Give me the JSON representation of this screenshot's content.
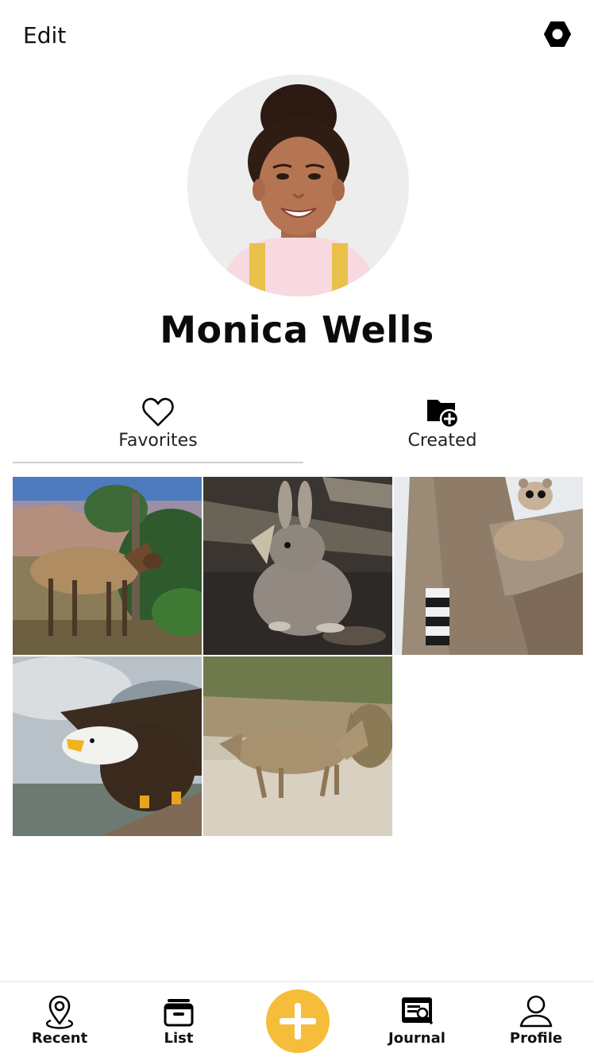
{
  "header": {
    "edit_label": "Edit",
    "settings_icon": "gear-hexagon-icon"
  },
  "profile": {
    "name": "Monica Wells",
    "avatar_icon": "avatar-photo"
  },
  "tabs": [
    {
      "label": "Favorites",
      "icon": "heart-icon",
      "active": true
    },
    {
      "label": "Created",
      "icon": "folder-add-icon",
      "active": false
    }
  ],
  "photos": [
    {
      "subject": "elk"
    },
    {
      "subject": "rabbit"
    },
    {
      "subject": "ringtail"
    },
    {
      "subject": "bald eagle"
    },
    {
      "subject": "coyote"
    }
  ],
  "bottom_nav": {
    "items": [
      {
        "label": "Recent",
        "icon": "map-pin-icon"
      },
      {
        "label": "List",
        "icon": "list-box-icon"
      },
      {
        "label": "",
        "icon": "plus-icon"
      },
      {
        "label": "Journal",
        "icon": "journal-icon"
      },
      {
        "label": "Profile",
        "icon": "user-icon"
      }
    ],
    "accent_color": "#f6bd3a"
  },
  "colors": {
    "accent": "#f6bd3a",
    "text": "#111111",
    "tab_underline": "#cfcfcf"
  }
}
